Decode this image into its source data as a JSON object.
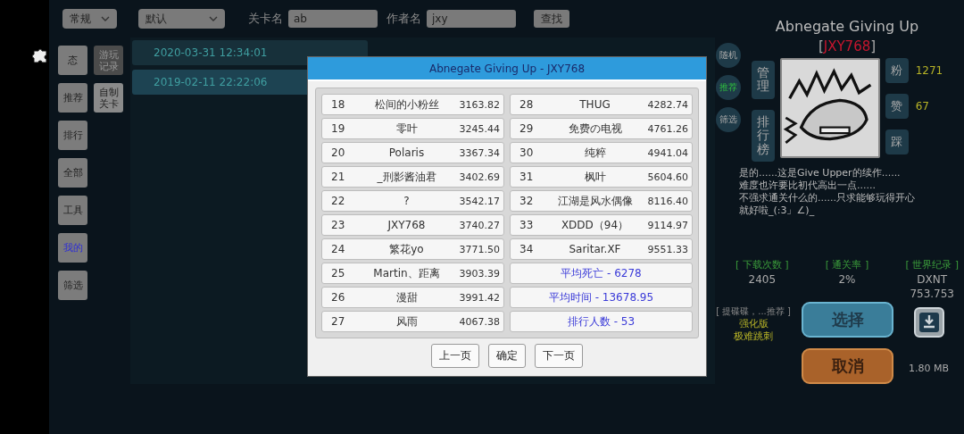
{
  "filters": {
    "mode": "常规",
    "sort": "默认",
    "level_label": "关卡名",
    "level_value": "ab",
    "author_label": "作者名",
    "author_value": "jxy",
    "search_button": "查找"
  },
  "sidebar": {
    "main": [
      {
        "label": "态",
        "selected": false
      },
      {
        "label": "推荐",
        "selected": false
      },
      {
        "label": "排行",
        "selected": false
      },
      {
        "label": "全部",
        "selected": false
      },
      {
        "label": "工具",
        "selected": false
      },
      {
        "label": "我的",
        "selected": true
      },
      {
        "label": "筛选",
        "selected": false
      }
    ],
    "secondary": [
      {
        "label": "游玩记录",
        "selected": true
      },
      {
        "label": "自制关卡",
        "selected": false
      }
    ]
  },
  "records": [
    {
      "time": "2020-03-31 12:34:01",
      "selected": false
    },
    {
      "time": "2019-02-11 22:22:06",
      "selected": true
    }
  ],
  "round_buttons": [
    {
      "label": "随机",
      "selected": false
    },
    {
      "label": "推荐",
      "selected": true
    },
    {
      "label": "筛选",
      "selected": false
    }
  ],
  "dialog": {
    "title": "Abnegate Giving Up - JXY768",
    "rankings": [
      {
        "rank": "18",
        "name": "松间的小粉丝",
        "time": "3163.82"
      },
      {
        "rank": "19",
        "name": "零叶",
        "time": "3245.44"
      },
      {
        "rank": "20",
        "name": "Polaris",
        "time": "3367.34"
      },
      {
        "rank": "21",
        "name": "_刑影酱油君",
        "time": "3402.69"
      },
      {
        "rank": "22",
        "name": "?",
        "time": "3542.17"
      },
      {
        "rank": "23",
        "name": "JXY768",
        "time": "3740.27"
      },
      {
        "rank": "24",
        "name": "繁花yo",
        "time": "3771.50"
      },
      {
        "rank": "25",
        "name": "Martin、距离",
        "time": "3903.39"
      },
      {
        "rank": "26",
        "name": "漫甜",
        "time": "3991.42"
      },
      {
        "rank": "27",
        "name": "风雨",
        "time": "4067.38"
      },
      {
        "rank": "28",
        "name": "THUG",
        "time": "4282.74"
      },
      {
        "rank": "29",
        "name": "免费の电视",
        "time": "4761.26"
      },
      {
        "rank": "30",
        "name": "纯粹",
        "time": "4941.04"
      },
      {
        "rank": "31",
        "name": "枫叶",
        "time": "5604.60"
      },
      {
        "rank": "32",
        "name": "江湖是风水偶像",
        "time": "8116.40"
      },
      {
        "rank": "33",
        "name": "XDDD（94）",
        "time": "9114.97"
      },
      {
        "rank": "34",
        "name": "Saritar.XF",
        "time": "9551.33"
      }
    ],
    "stats": [
      "平均死亡 - 6278",
      "平均时间 - 13678.95",
      "排行人数 - 53"
    ],
    "buttons": [
      "上一页",
      "确定",
      "下一页"
    ]
  },
  "level": {
    "title": "Abnegate Giving Up",
    "author": "JXY768",
    "author_brackets": [
      "[",
      "]"
    ],
    "side_buttons": [
      "管理",
      "排行榜"
    ],
    "reactions": [
      {
        "label": "粉",
        "count": "1271"
      },
      {
        "label": "赞",
        "count": "67"
      },
      {
        "label": "踩"
      }
    ],
    "description": [
      "是的......这是Give Upper的续作......",
      "难度也许要比初代高出一点......",
      "不强求通关什么的......只求能够玩得开心",
      "就好啦_(:3」∠)_"
    ],
    "stats": [
      {
        "label": "[ 下载次数 ]",
        "value": [
          "2405"
        ]
      },
      {
        "label": "[ 通关率 ]",
        "value": [
          "2%"
        ]
      },
      {
        "label": "[ 世界纪录 ]",
        "value": [
          "DXNT",
          "753.753"
        ]
      }
    ],
    "tag_header": "[ 提碟碟，...推荐 ]",
    "tags": [
      "强化版",
      "极难跳刺"
    ],
    "select_button": "选择",
    "cancel_button": "取消",
    "size": "1.80 MB"
  }
}
